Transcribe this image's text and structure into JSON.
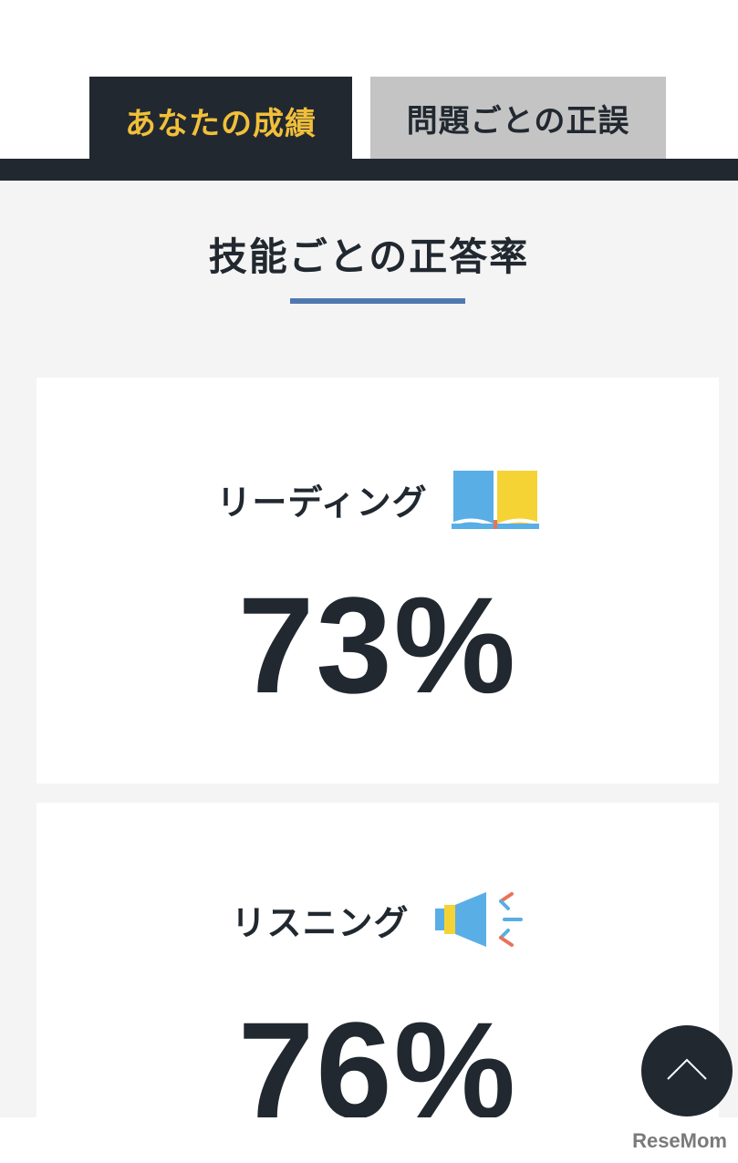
{
  "tabs": [
    {
      "label": "あなたの成績",
      "active": true
    },
    {
      "label": "問題ごとの正誤",
      "active": false
    }
  ],
  "section": {
    "title": "技能ごとの正答率"
  },
  "skills": [
    {
      "label": "リーディング",
      "icon": "open-book-icon",
      "percent": "73%"
    },
    {
      "label": "リスニング",
      "icon": "speaker-icon",
      "percent": "76%"
    }
  ],
  "watermark": "ReseMom",
  "colors": {
    "dark": "#212830",
    "accent": "#f1bf3a",
    "tab_inactive": "#c4c4c4",
    "underline": "#4f78b0",
    "icon_blue": "#5aaee6",
    "icon_yellow": "#f6d335",
    "icon_red": "#e8735a",
    "background": "#f4f4f4"
  }
}
